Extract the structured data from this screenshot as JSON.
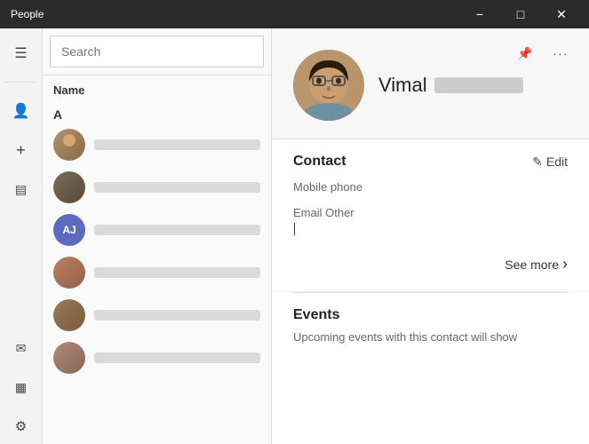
{
  "titleBar": {
    "title": "People",
    "minimizeLabel": "−",
    "maximizeLabel": "□",
    "closeLabel": "✕"
  },
  "sidebar": {
    "hamburgerIcon": "☰",
    "icons": [
      {
        "name": "person-icon",
        "glyph": "👤",
        "label": "Contacts"
      },
      {
        "name": "add-icon",
        "glyph": "+",
        "label": "New contact"
      },
      {
        "name": "filter-icon",
        "glyph": "⊟",
        "label": "Filter"
      },
      {
        "name": "mail-icon",
        "glyph": "✉",
        "label": "Mail"
      },
      {
        "name": "calendar-icon",
        "glyph": "📅",
        "label": "Calendar"
      },
      {
        "name": "settings-icon",
        "glyph": "⚙",
        "label": "Settings"
      }
    ]
  },
  "contactList": {
    "searchPlaceholder": "Search",
    "headerLabel": "Name",
    "alphaGroup": "A",
    "contacts": [
      {
        "id": 1,
        "type": "photo",
        "initials": ""
      },
      {
        "id": 2,
        "type": "photo",
        "initials": ""
      },
      {
        "id": 3,
        "type": "initials",
        "initials": "AJ",
        "color": "#5c6bc0"
      },
      {
        "id": 4,
        "type": "photo",
        "initials": ""
      },
      {
        "id": 5,
        "type": "photo",
        "initials": ""
      },
      {
        "id": 6,
        "type": "photo",
        "initials": ""
      }
    ]
  },
  "detail": {
    "contactName": "Vimal",
    "pinIcon": "📌",
    "moreIcon": "•••",
    "editIcon": "✎",
    "editLabel": "Edit",
    "contactSectionTitle": "Contact",
    "fields": [
      {
        "label": "Mobile phone",
        "value": ""
      },
      {
        "label": "Email Other",
        "value": ""
      }
    ],
    "seeMoreLabel": "See more",
    "chevronRight": "›",
    "eventsSectionTitle": "Events",
    "eventsDesc": "Upcoming events with this contact will show"
  }
}
